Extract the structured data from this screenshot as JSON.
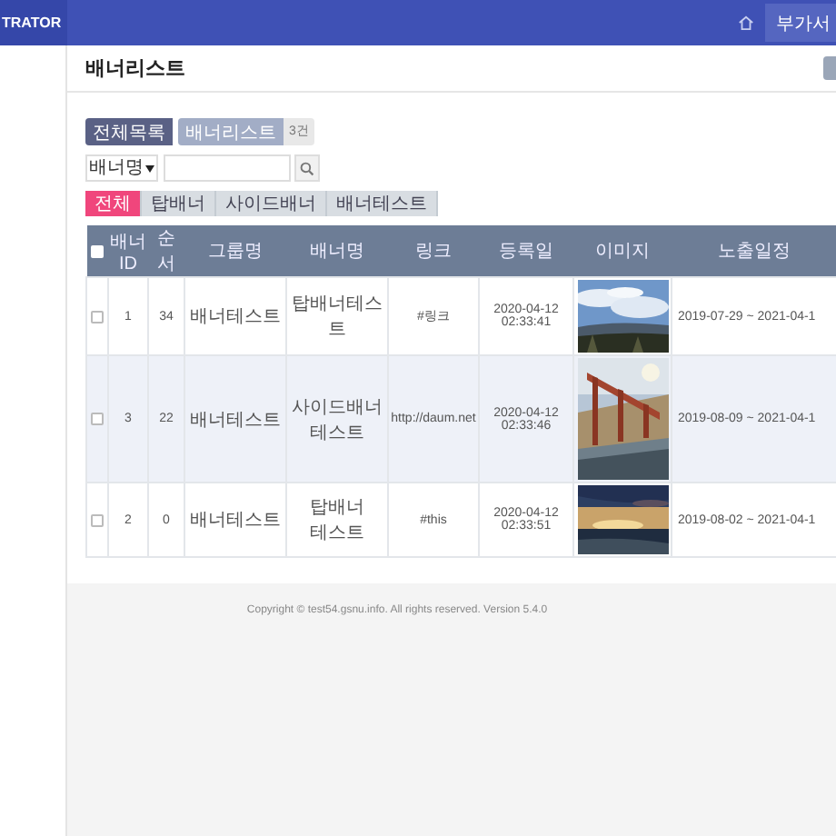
{
  "topbar": {
    "brand": "TRATOR",
    "menu_button": "부가서"
  },
  "page_title": "배너리스트",
  "list_buttons": [
    {
      "label": "전체목록",
      "selected": true
    },
    {
      "label": "배너리스트",
      "selected": false
    }
  ],
  "count": "3건",
  "search": {
    "select": "배너명"
  },
  "tabs": [
    {
      "label": "전체",
      "selected": true
    },
    {
      "label": "탑배너",
      "selected": false
    },
    {
      "label": "사이드배너",
      "selected": false
    },
    {
      "label": "배너테스트",
      "selected": false
    }
  ],
  "table": {
    "all_checked": false,
    "columns": [
      "배너ID",
      "순서",
      "그룹명",
      "배너명",
      "링크",
      "등록일",
      "이미지",
      "노출일정"
    ],
    "rows": [
      {
        "checked": false,
        "selected": false,
        "cells": [
          "1",
          "34",
          "배너테스트",
          "탑배너테스트",
          "#링크",
          "2020-04-12 02:33:41"
        ],
        "schedule": "2019-07-29 ~ 2021-04-1"
      },
      {
        "checked": false,
        "selected": true,
        "cells": [
          "3",
          "22",
          "배너테스트",
          "사이드배너테스트",
          "http://daum.net",
          "2020-04-12 02:33:46"
        ],
        "schedule": "2019-08-09 ~ 2021-04-1"
      },
      {
        "checked": false,
        "selected": false,
        "cells": [
          "2",
          "0",
          "배너테스트",
          "탑배너 테스트",
          "#this",
          "2020-04-12 02:33:51"
        ],
        "schedule": "2019-08-02 ~ 2021-04-1"
      }
    ]
  },
  "footer": "Copyright © test54.gsnu.info. All rights reserved. Version 5.4.0"
}
